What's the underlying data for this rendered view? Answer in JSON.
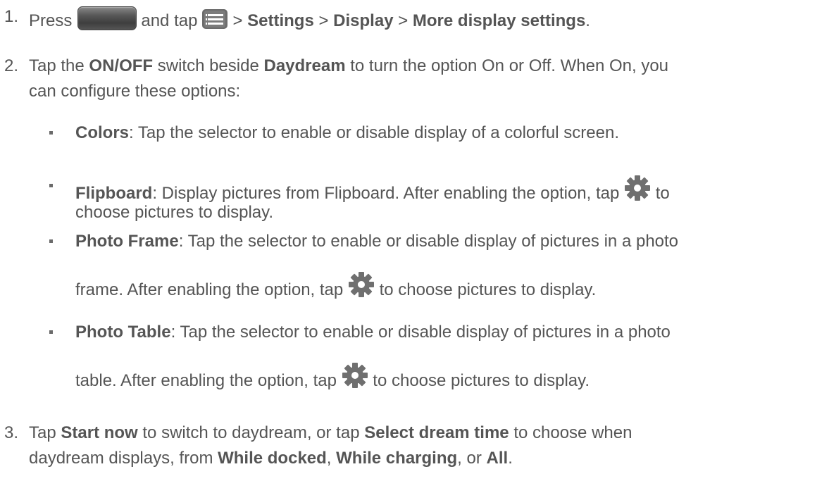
{
  "steps": [
    {
      "number": "1.",
      "press": "Press",
      "and_tap": "and tap",
      "sep1": ">",
      "settings": "Settings",
      "sep2": ">",
      "display": "Display",
      "sep3": ">",
      "more_display": "More display settings",
      "period": "."
    },
    {
      "number": "2.",
      "tap": "Tap the",
      "onoff": "ON/OFF",
      "switch_beside": "switch beside",
      "daydream": "Daydream",
      "rest_line1": "to turn the option On or Off. When On, you",
      "line2": "can configure these options:"
    },
    {
      "number": "3.",
      "tap": "Tap",
      "start_now": "Start now",
      "mid": "to switch to daydream, or tap",
      "select_dream": "Select dream time",
      "end_line1": "to choose when",
      "line2_start": "daydream displays, from",
      "while_docked": "While docked",
      "comma1": ",",
      "while_charging": "While charging",
      "or": ", or",
      "all": "All",
      "period": "."
    }
  ],
  "options": [
    {
      "name": "Colors",
      "text": ": Tap the selector to enable or disable display of a colorful screen."
    },
    {
      "name": "Flipboard",
      "text_line1": ": Display pictures from Flipboard. After enabling the option, tap",
      "text_line1_end": "to",
      "text_line2": "choose pictures to display."
    },
    {
      "name": "Photo Frame",
      "text_line1": ": Tap the selector to enable or disable display of pictures in a photo",
      "text_line2_start": "frame. After enabling the option, tap",
      "text_line2_end": "to choose pictures to display."
    },
    {
      "name": "Photo Table",
      "text_line1": ": Tap the selector to enable or disable display of pictures in a photo",
      "text_line2_start": "table. After enabling the option, tap",
      "text_line2_end": "to choose pictures to display."
    }
  ],
  "icons": {
    "home_button": "home-button-icon",
    "menu": "menu-icon",
    "settings": "gear-icon"
  },
  "colors": {
    "text": "#555555",
    "icon_gray": "#6f6f6f"
  }
}
